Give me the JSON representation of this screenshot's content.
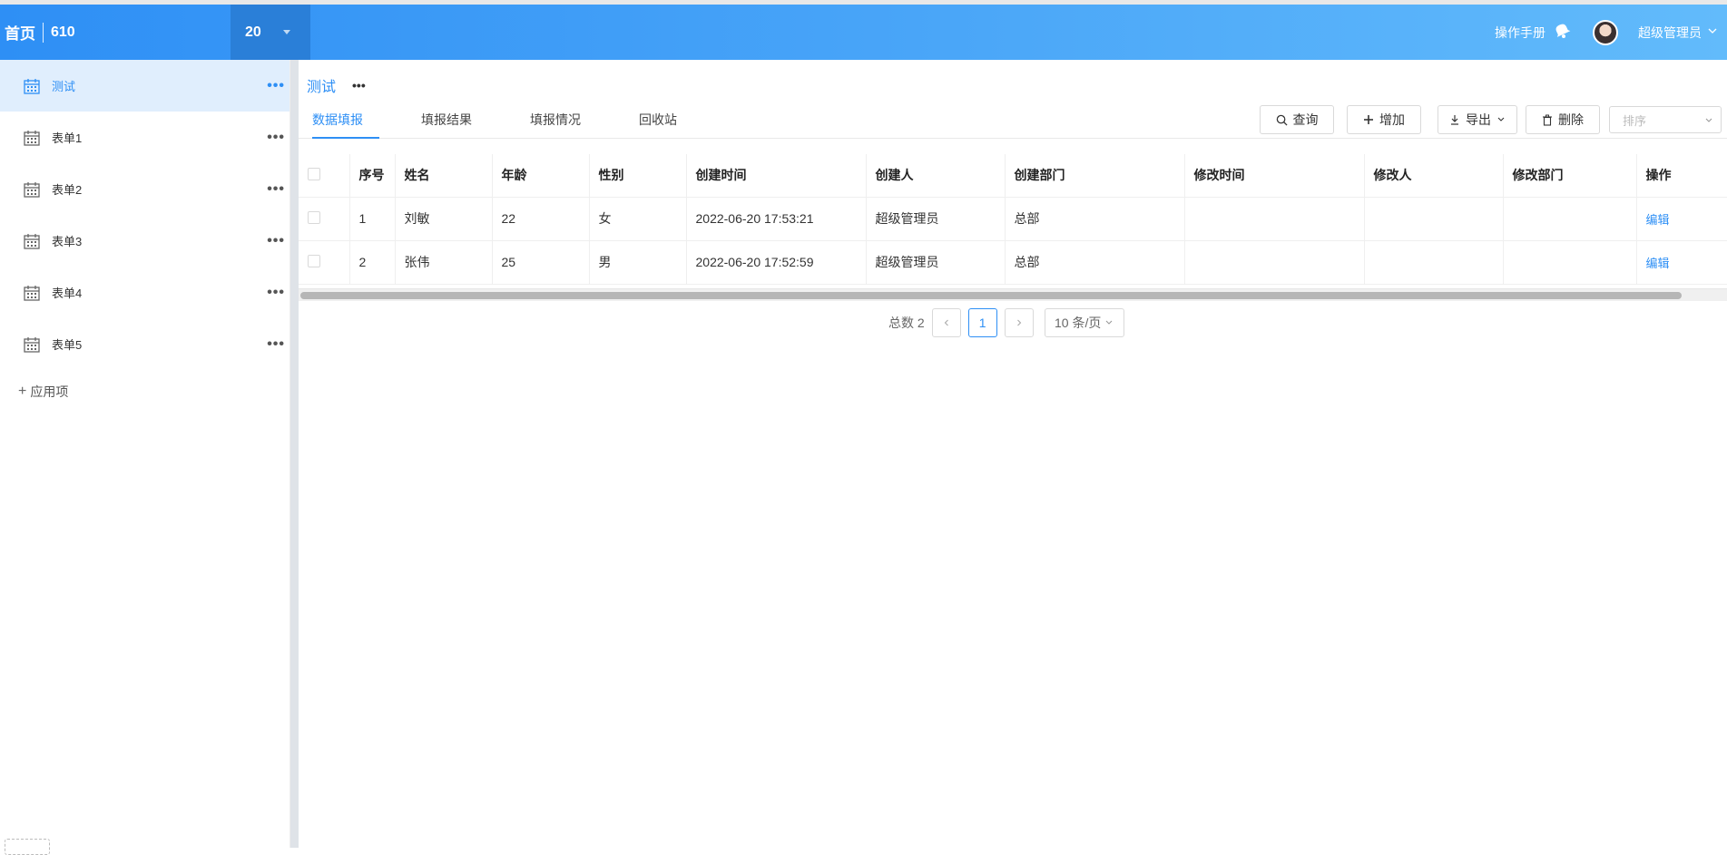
{
  "header": {
    "home_label": "首页",
    "app_number": "610",
    "select_value": "20",
    "manual_label": "操作手册",
    "user_name": "超级管理员"
  },
  "sidebar": {
    "items": [
      {
        "label": "测试",
        "active": true
      },
      {
        "label": "表单1",
        "active": false
      },
      {
        "label": "表单2",
        "active": false
      },
      {
        "label": "表单3",
        "active": false
      },
      {
        "label": "表单4",
        "active": false
      },
      {
        "label": "表单5",
        "active": false
      }
    ],
    "more_glyph": "•••",
    "add_label": "应用项"
  },
  "panel": {
    "title": "测试",
    "title_more": "•••",
    "tabs": [
      {
        "label": "数据填报",
        "active": true
      },
      {
        "label": "填报结果",
        "active": false
      },
      {
        "label": "填报情况",
        "active": false
      },
      {
        "label": "回收站",
        "active": false
      }
    ],
    "toolbar": {
      "query": "查询",
      "add": "增加",
      "export": "导出",
      "delete": "删除",
      "sort_placeholder": "排序"
    }
  },
  "table": {
    "columns": [
      "序号",
      "姓名",
      "年龄",
      "性别",
      "创建时间",
      "创建人",
      "创建部门",
      "修改时间",
      "修改人",
      "修改部门",
      "操作"
    ],
    "rows": [
      {
        "no": "1",
        "name": "刘敏",
        "age": "22",
        "gender": "女",
        "created": "2022-06-20 17:53:21",
        "creator": "超级管理员",
        "dept": "总部",
        "modified": "",
        "modifier": "",
        "mod_dept": "",
        "action": "编辑"
      },
      {
        "no": "2",
        "name": "张伟",
        "age": "25",
        "gender": "男",
        "created": "2022-06-20 17:52:59",
        "creator": "超级管理员",
        "dept": "总部",
        "modified": "",
        "modifier": "",
        "mod_dept": "",
        "action": "编辑"
      }
    ]
  },
  "pagination": {
    "total_label": "总数 2",
    "current_page": "1",
    "page_size": "10 条/页"
  },
  "colors": {
    "accent": "#2e8ff5",
    "header_start": "#2e8ff5",
    "header_end": "#62bbfb",
    "active_bg": "#e0eefd"
  }
}
